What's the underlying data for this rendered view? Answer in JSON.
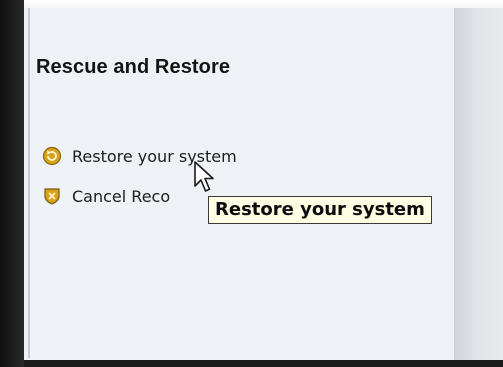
{
  "panel": {
    "title": "Rescue and Restore",
    "items": [
      {
        "label": "Restore your system",
        "icon": "restore-icon"
      },
      {
        "label": "Cancel Reco",
        "icon": "cancel-shield-icon"
      }
    ]
  },
  "tooltip": {
    "text": "Restore your system"
  },
  "colors": {
    "panel_bg": "#eef1f5",
    "icon_gold": "#d8a21c",
    "tooltip_bg": "#fffde3"
  }
}
